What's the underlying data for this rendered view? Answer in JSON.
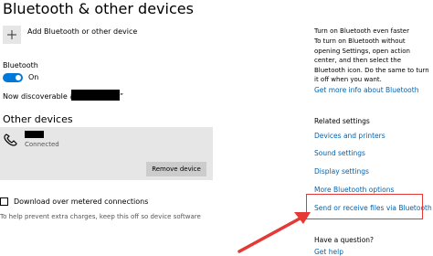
{
  "page": {
    "title": "Bluetooth & other devices",
    "add_device_label": "Add Bluetooth or other device",
    "bluetooth_label": "Bluetooth",
    "toggle_state": "On",
    "discoverable_prefix": "Now discoverable as “",
    "discoverable_suffix": "”",
    "other_devices_heading": "Other devices",
    "device_status": "Connected",
    "remove_button": "Remove device",
    "metered_label": "Download over metered connections",
    "metered_help": "To help prevent extra charges, keep this off so device software"
  },
  "sidebar": {
    "tip_heading": "Turn on Bluetooth even faster",
    "tip_lines": [
      "To turn on Bluetooth without",
      "opening Settings, open action",
      "center, and then select the",
      "Bluetooth icon. Do the same to turn",
      "it off when you want."
    ],
    "more_info_link": "Get more info about Bluetooth",
    "related_heading": "Related settings",
    "related_links": [
      "Devices and printers",
      "Sound settings",
      "Display settings",
      "More Bluetooth options",
      "Send or receive files via Bluetooth"
    ],
    "question_heading": "Have a question?",
    "help_link": "Get help"
  },
  "colors": {
    "accent": "#0078d7",
    "link": "#0063b1",
    "annotation": "#e53935",
    "card_bg": "#e6e6e6"
  },
  "icons": {
    "add": "plus-icon",
    "device": "phone-icon"
  }
}
